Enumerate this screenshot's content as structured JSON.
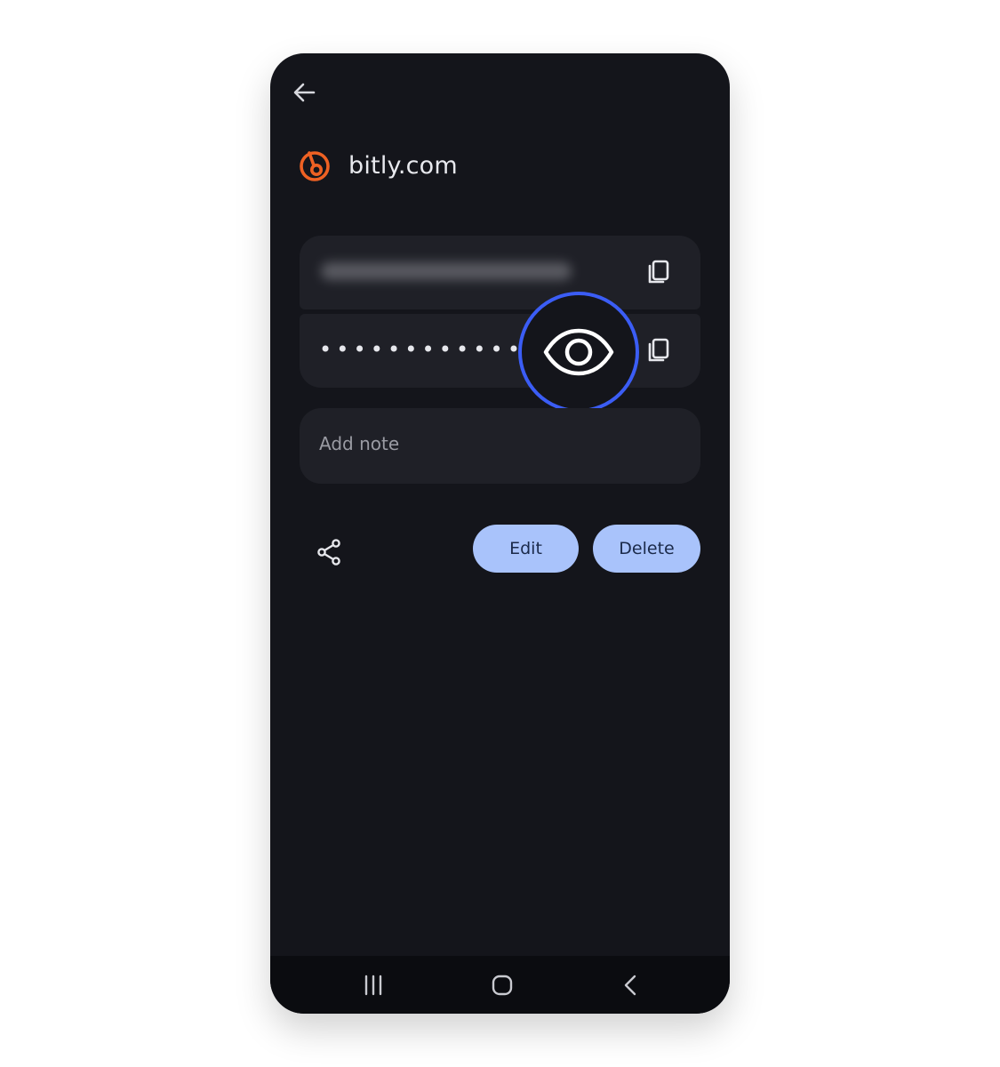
{
  "site": {
    "name": "bitly.com",
    "brand_color": "#ee6123"
  },
  "credentials": {
    "password_masked": "•••••••••••••••"
  },
  "note": {
    "placeholder": "Add note"
  },
  "actions": {
    "edit_label": "Edit",
    "delete_label": "Delete"
  },
  "icons": {
    "back": "arrow-left-icon",
    "copy": "copy-icon",
    "reveal": "eye-icon",
    "share": "share-icon",
    "nav_recents": "recents-icon",
    "nav_home": "home-icon",
    "nav_back": "chevron-left-icon"
  },
  "colors": {
    "background": "#14151b",
    "field": "#1f2027",
    "accent_pill": "#a9c3fb",
    "highlight_ring": "#3b5df5"
  }
}
